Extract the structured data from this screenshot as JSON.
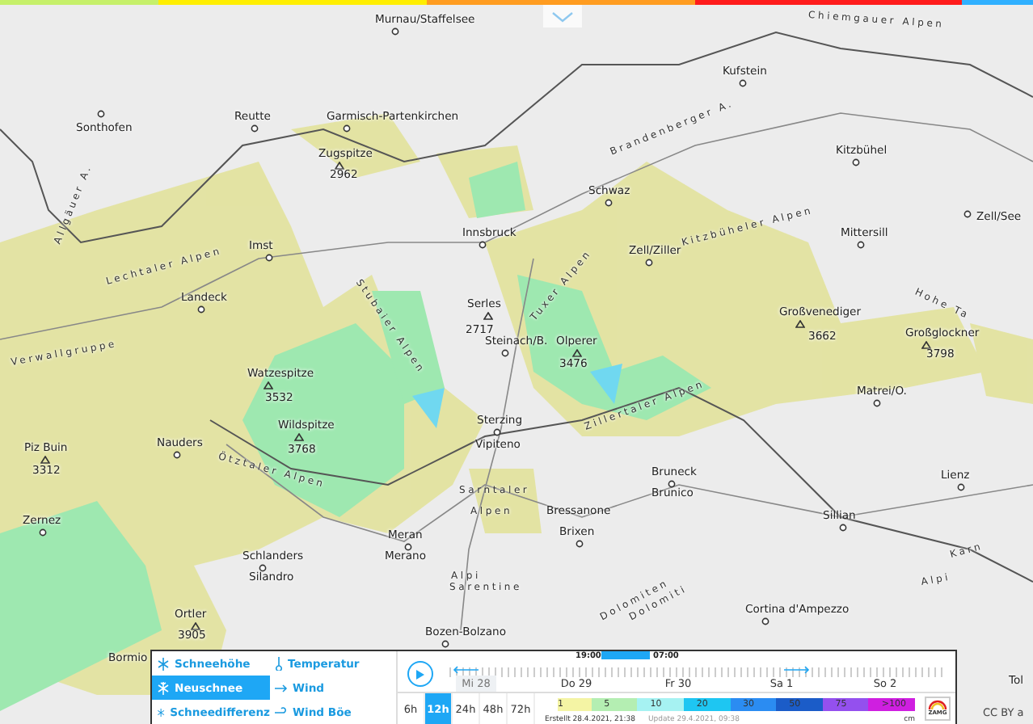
{
  "map": {
    "labels": [
      {
        "text": "Murnau/Staffelsee",
        "kind": "town"
      },
      {
        "text": "Chiemgauer Alpen",
        "kind": "range"
      },
      {
        "text": "Kufstein",
        "kind": "town"
      },
      {
        "text": "Sonthofen",
        "kind": "town"
      },
      {
        "text": "Reutte",
        "kind": "town"
      },
      {
        "text": "Garmisch-Partenkirchen",
        "kind": "town"
      },
      {
        "text": "Brandenberger A.",
        "kind": "range"
      },
      {
        "text": "Kitzbühel",
        "kind": "town"
      },
      {
        "text": "Zugspitze",
        "kind": "peak"
      },
      {
        "text": "2962",
        "kind": "text"
      },
      {
        "text": "Allgäuer A.",
        "kind": "range"
      },
      {
        "text": "Schwaz",
        "kind": "town"
      },
      {
        "text": "Kitzbüheler Alpen",
        "kind": "range"
      },
      {
        "text": "Zell/See",
        "kind": "town"
      },
      {
        "text": "Mittersill",
        "kind": "town"
      },
      {
        "text": "Innsbruck",
        "kind": "town"
      },
      {
        "text": "Imst",
        "kind": "town"
      },
      {
        "text": "Zell/Ziller",
        "kind": "town"
      },
      {
        "text": "Lechtaler Alpen",
        "kind": "range"
      },
      {
        "text": "Stubaier Alpen",
        "kind": "range"
      },
      {
        "text": "Tuxer Alpen",
        "kind": "range"
      },
      {
        "text": "Landeck",
        "kind": "town"
      },
      {
        "text": "Serles",
        "kind": "peak"
      },
      {
        "text": "2717",
        "kind": "text"
      },
      {
        "text": "Steinach/B.",
        "kind": "town"
      },
      {
        "text": "Großvenediger",
        "kind": "peak"
      },
      {
        "text": "3662",
        "kind": "text"
      },
      {
        "text": "Hohe Ta",
        "kind": "range"
      },
      {
        "text": "Großglockner",
        "kind": "peak"
      },
      {
        "text": "3798",
        "kind": "text"
      },
      {
        "text": "Olperer",
        "kind": "peak"
      },
      {
        "text": "3476",
        "kind": "text"
      },
      {
        "text": "Verwallgruppe",
        "kind": "range"
      },
      {
        "text": "Zillertaler Alpen",
        "kind": "range"
      },
      {
        "text": "Watzespitze",
        "kind": "peak"
      },
      {
        "text": "3532",
        "kind": "text"
      },
      {
        "text": "Matrei/O.",
        "kind": "town"
      },
      {
        "text": "Wildspitze",
        "kind": "peak"
      },
      {
        "text": "3768",
        "kind": "text"
      },
      {
        "text": "Sterzing",
        "kind": "town"
      },
      {
        "text": "Piz Buin",
        "kind": "peak"
      },
      {
        "text": "Nauders",
        "kind": "town"
      },
      {
        "text": "Vipiteno",
        "kind": "text"
      },
      {
        "text": "3312",
        "kind": "text"
      },
      {
        "text": "Ötztaler Alpen",
        "kind": "range"
      },
      {
        "text": "Bruneck",
        "kind": "town"
      },
      {
        "text": "Brunico",
        "kind": "text"
      },
      {
        "text": "Lienz",
        "kind": "town"
      },
      {
        "text": "Sarntaler",
        "kind": "range"
      },
      {
        "text": "Alpen",
        "kind": "range"
      },
      {
        "text": "Bressanone",
        "kind": "text"
      },
      {
        "text": "Brixen",
        "kind": "town"
      },
      {
        "text": "Sillian",
        "kind": "town"
      },
      {
        "text": "Zernez",
        "kind": "town"
      },
      {
        "text": "Meran",
        "kind": "town"
      },
      {
        "text": "Merano",
        "kind": "text"
      },
      {
        "text": "Karn",
        "kind": "range"
      },
      {
        "text": "Dolomiten",
        "kind": "range"
      },
      {
        "text": "Schlanders",
        "kind": "town"
      },
      {
        "text": "Silandro",
        "kind": "text"
      },
      {
        "text": "Alpi",
        "kind": "range"
      },
      {
        "text": "Sarentine",
        "kind": "range"
      },
      {
        "text": "Dolomiti",
        "kind": "range"
      },
      {
        "text": "Alpi",
        "kind": "range"
      },
      {
        "text": "Ortler",
        "kind": "peak"
      },
      {
        "text": "Cortina d'Ampezzo",
        "kind": "town"
      },
      {
        "text": "3905",
        "kind": "text"
      },
      {
        "text": "Bozen-Bolzano",
        "kind": "town"
      },
      {
        "text": "Bormio",
        "kind": "text"
      },
      {
        "text": "Tol",
        "kind": "text"
      }
    ],
    "attribution": "CC BY a"
  },
  "parameters": [
    {
      "label": "Schneehöhe",
      "selected": false,
      "kind": "snow"
    },
    {
      "label": "Temperatur",
      "selected": false,
      "kind": "thermo"
    },
    {
      "label": "Neuschnee",
      "selected": true,
      "kind": "newsnow"
    },
    {
      "label": "Wind",
      "selected": false,
      "kind": "wind"
    },
    {
      "label": "Schneedifferenz",
      "selected": false,
      "kind": "snow"
    },
    {
      "label": "Wind Böe",
      "selected": false,
      "kind": "gust"
    }
  ],
  "timeline": {
    "start": "19:00",
    "end": "07:00",
    "days": [
      {
        "label": "Mi 28",
        "selected": true
      },
      {
        "label": "Do 29",
        "selected": false
      },
      {
        "label": "Fr 30",
        "selected": false
      },
      {
        "label": "Sa 1",
        "selected": false
      },
      {
        "label": "So 2",
        "selected": false
      }
    ]
  },
  "intervals": [
    {
      "label": "6h",
      "selected": false
    },
    {
      "label": "12h",
      "selected": true
    },
    {
      "label": "24h",
      "selected": false
    },
    {
      "label": "48h",
      "selected": false
    },
    {
      "label": "72h",
      "selected": false
    }
  ],
  "legend": {
    "steps": [
      {
        "label": "1",
        "color": "#f4f4a4"
      },
      {
        "label": "5",
        "color": "#b4eeb2"
      },
      {
        "label": "10",
        "color": "#a6f2f2"
      },
      {
        "label": "20",
        "color": "#1ec6f2"
      },
      {
        "label": "30",
        "color": "#2b8cf2"
      },
      {
        "label": "50",
        "color": "#1b5cc8"
      },
      {
        "label": "75",
        "color": "#9450ee"
      },
      {
        "label": ">100",
        "color": "#cf1fe0"
      }
    ],
    "unit": "cm"
  },
  "created": "Erstellt 28.4.2021, 21:38",
  "updated": "Update 29.4.2021, 09:38",
  "logo": "ZAMG"
}
